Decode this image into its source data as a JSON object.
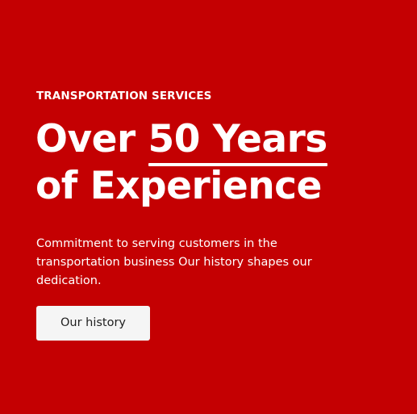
{
  "hero": {
    "eyebrow": "TRANSPORTATION SERVICES",
    "headline": {
      "line1_prefix": "Over ",
      "line1_highlight": "50 Years",
      "line2": "of Experience"
    },
    "description": "Commitment to serving customers in the transportation business Our history shapes our dedication.",
    "cta_label": "Our history"
  },
  "colors": {
    "background": "#c40002",
    "text": "#ffffff",
    "button_background": "#f5f5f5",
    "button_text": "#1f1f1f"
  }
}
